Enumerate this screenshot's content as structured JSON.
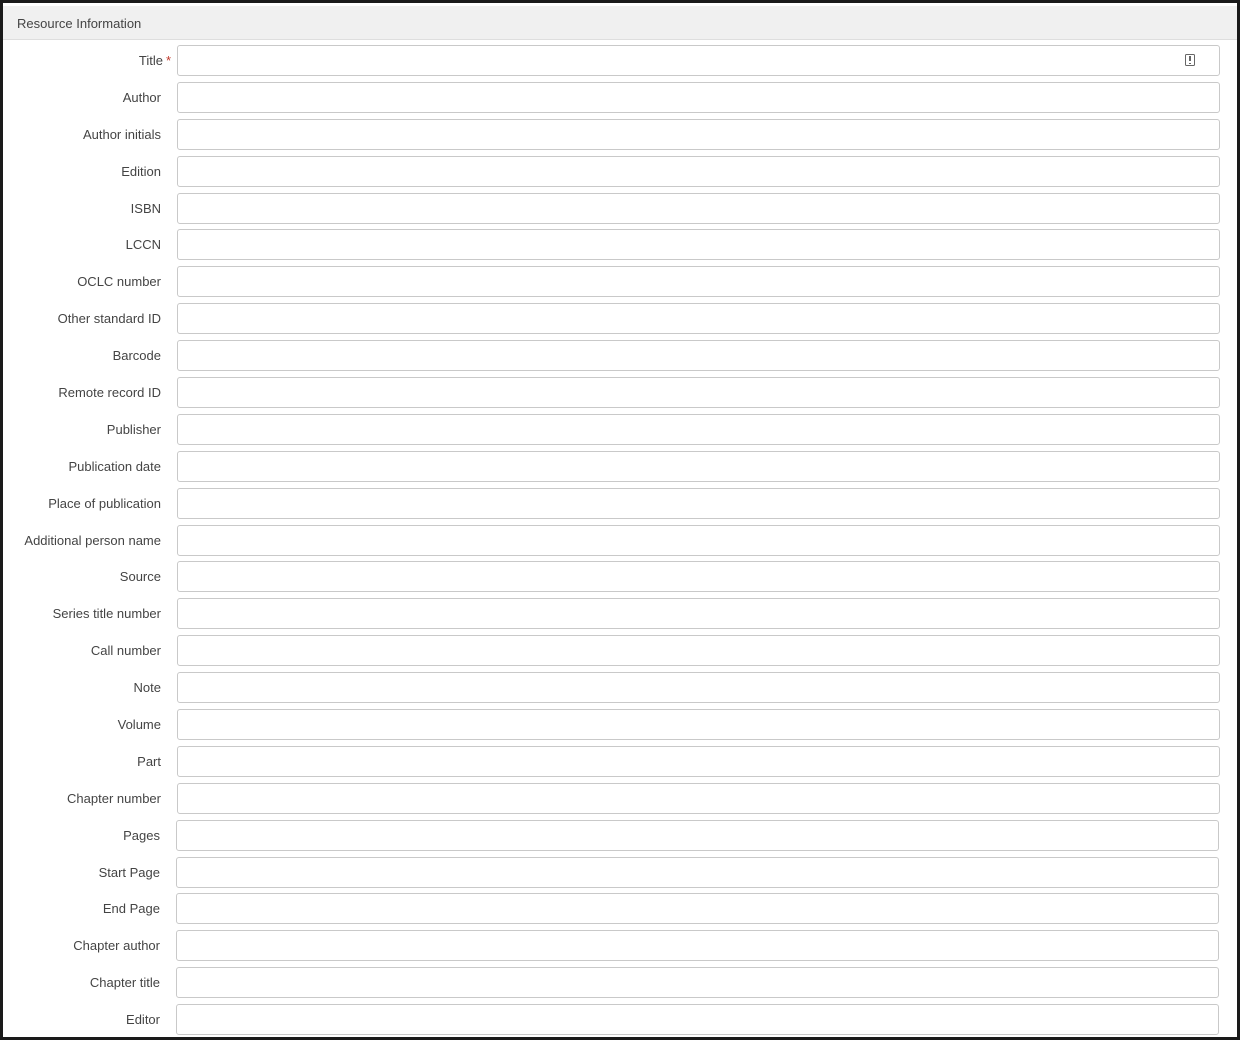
{
  "section": {
    "title": "Resource Information"
  },
  "fields": [
    {
      "key": "title",
      "label": "Title",
      "required_mark": "*",
      "value": ""
    },
    {
      "key": "author",
      "label": "Author",
      "value": ""
    },
    {
      "key": "author-initials",
      "label": "Author initials",
      "value": ""
    },
    {
      "key": "edition",
      "label": "Edition",
      "value": ""
    },
    {
      "key": "isbn",
      "label": "ISBN",
      "value": ""
    },
    {
      "key": "lccn",
      "label": "LCCN",
      "value": ""
    },
    {
      "key": "oclc-number",
      "label": "OCLC number",
      "value": ""
    },
    {
      "key": "other-standard-id",
      "label": "Other standard ID",
      "value": ""
    },
    {
      "key": "barcode",
      "label": "Barcode",
      "value": ""
    },
    {
      "key": "remote-record-id",
      "label": "Remote record ID",
      "value": ""
    },
    {
      "key": "publisher",
      "label": "Publisher",
      "value": ""
    },
    {
      "key": "publication-date",
      "label": "Publication date",
      "value": ""
    },
    {
      "key": "place-of-publication",
      "label": "Place of publication",
      "value": ""
    },
    {
      "key": "additional-person-name",
      "label": "Additional person name",
      "value": ""
    },
    {
      "key": "source",
      "label": "Source",
      "value": ""
    },
    {
      "key": "series-title-number",
      "label": "Series title number",
      "value": ""
    },
    {
      "key": "call-number",
      "label": "Call number",
      "value": ""
    },
    {
      "key": "note",
      "label": "Note",
      "value": ""
    },
    {
      "key": "volume",
      "label": "Volume",
      "value": ""
    },
    {
      "key": "part",
      "label": "Part",
      "value": ""
    },
    {
      "key": "chapter-number",
      "label": "Chapter number",
      "value": ""
    },
    {
      "key": "pages",
      "label": "Pages",
      "value": ""
    },
    {
      "key": "start-page",
      "label": "Start Page",
      "value": ""
    },
    {
      "key": "end-page",
      "label": "End Page",
      "value": ""
    },
    {
      "key": "chapter-author",
      "label": "Chapter author",
      "value": ""
    },
    {
      "key": "chapter-title",
      "label": "Chapter title",
      "value": ""
    },
    {
      "key": "editor",
      "label": "Editor",
      "value": ""
    }
  ],
  "icons": {
    "title_field_icon": "info-badge-icon"
  },
  "colors": {
    "required": "#c0392b",
    "header_bg": "#f0f0f0",
    "label_text": "#444444",
    "input_border": "#c9c9c9"
  }
}
